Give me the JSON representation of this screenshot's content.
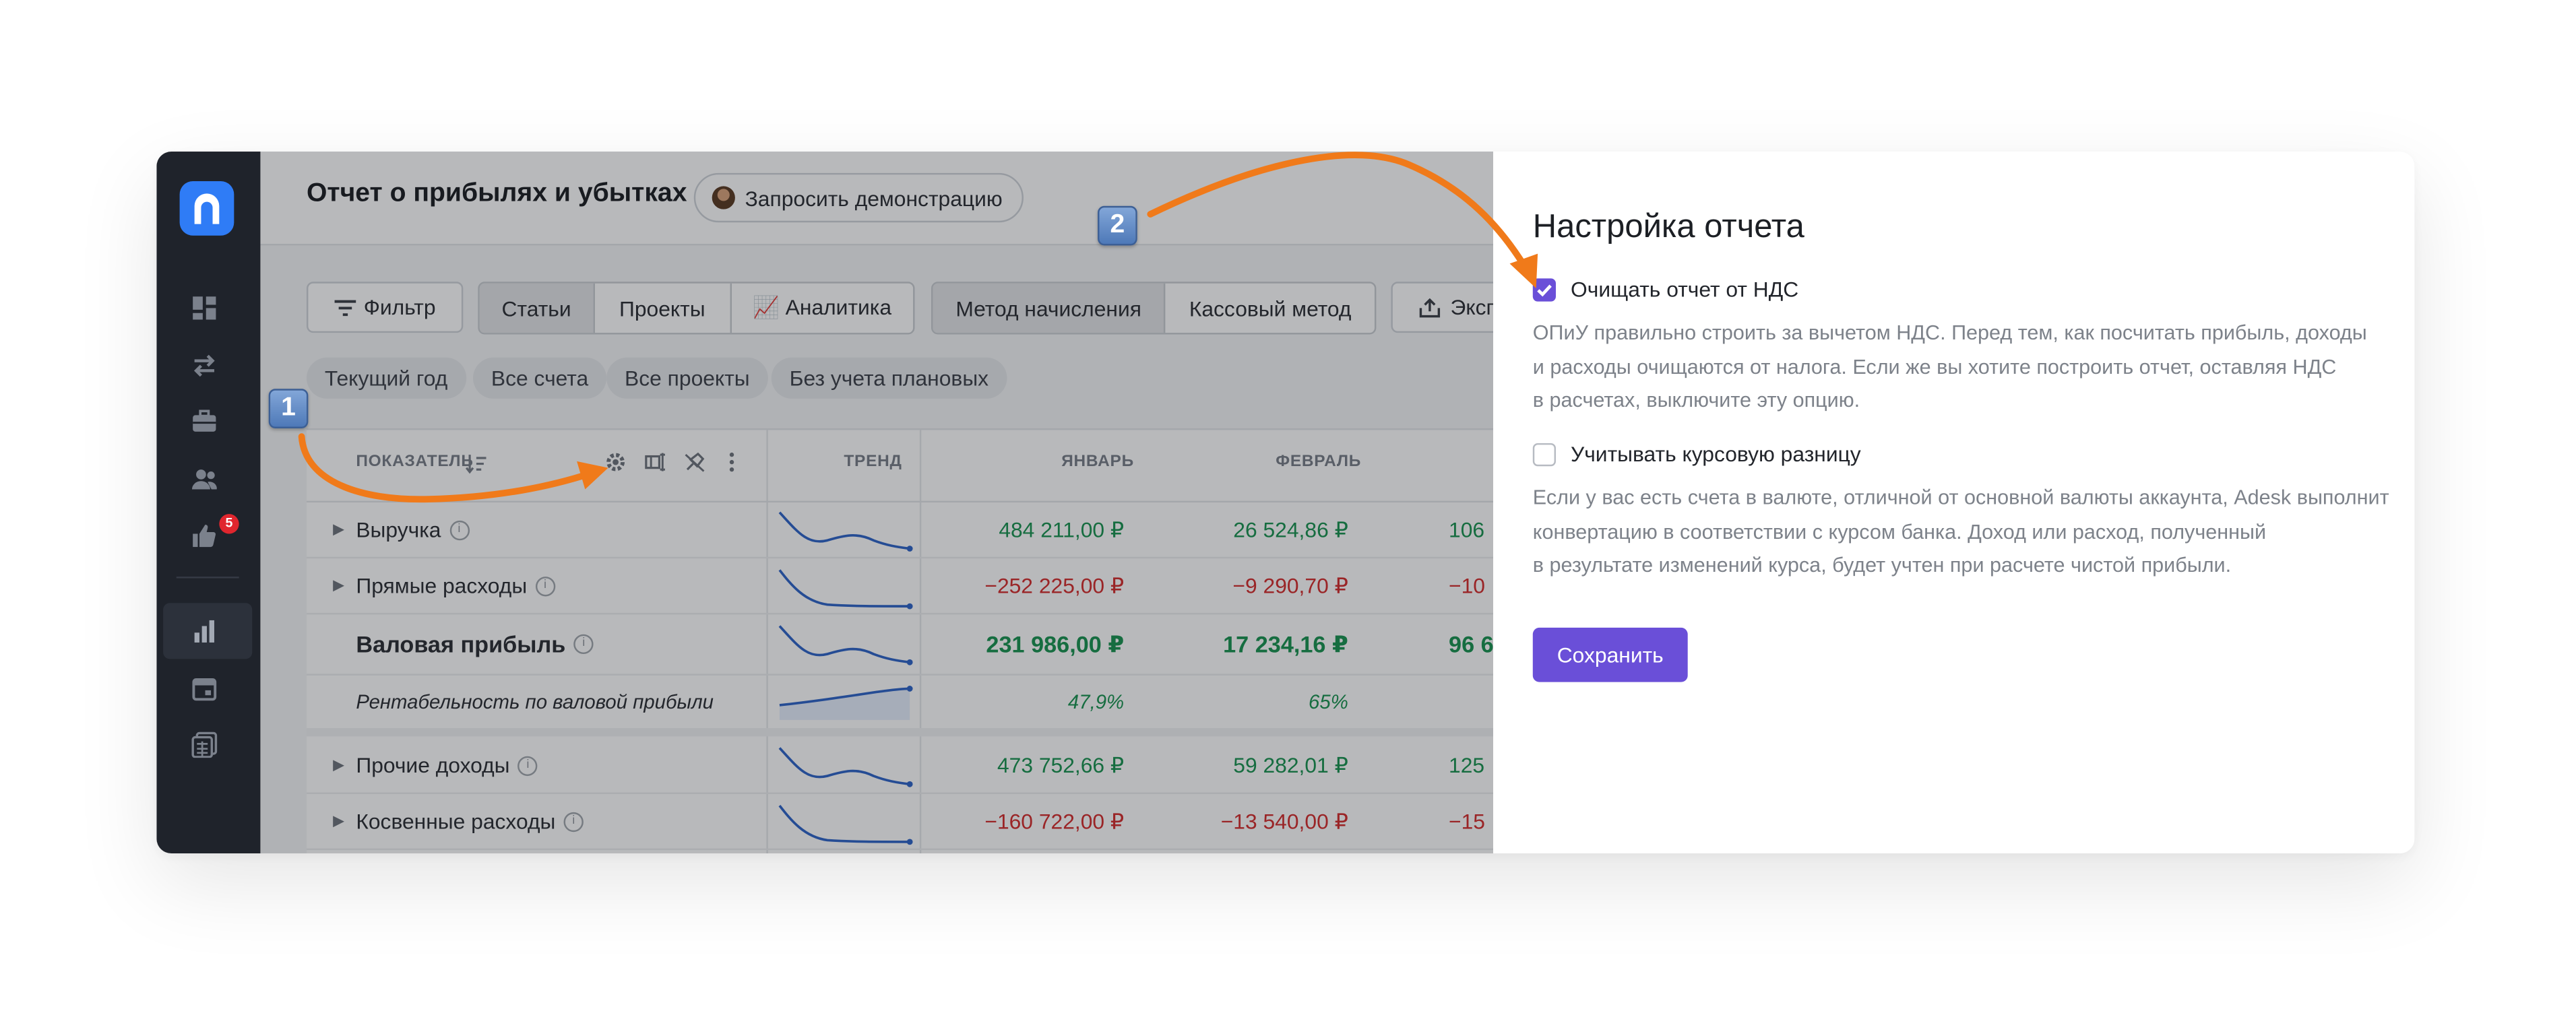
{
  "sidebar": {
    "items": [
      {
        "icon": "dashboard-icon"
      },
      {
        "icon": "transfer-arrows-icon"
      },
      {
        "icon": "briefcase-icon"
      },
      {
        "icon": "users-icon"
      },
      {
        "icon": "thumbs-up-icon",
        "badge": "5"
      },
      {
        "icon": "bar-chart-icon",
        "active": true
      },
      {
        "icon": "calendar-icon"
      },
      {
        "icon": "calculator-icon"
      }
    ]
  },
  "header": {
    "title": "Отчет о прибылях и убытках",
    "demo_button": "Запросить демонстрацию"
  },
  "toolbar": {
    "filter": "Фильтр",
    "view_tabs": [
      "Статьи",
      "Проекты",
      "📈 Аналитика"
    ],
    "method_tabs": [
      "Метод начисления",
      "Кассовый метод"
    ],
    "export": "Эксп"
  },
  "chips": [
    "Текущий год",
    "Все счета",
    "Все проекты",
    "Без учета плановых"
  ],
  "table": {
    "columns": {
      "indicator": "ПОКАЗАТЕЛЬ",
      "trend": "ТРЕНД",
      "month1": "ЯНВАРЬ",
      "month2": "ФЕВРАЛЬ"
    },
    "rows": [
      {
        "label": "Выручка",
        "v1": "484 211,00 ₽",
        "v2": "26 524,86 ₽",
        "v3": "106 "
      },
      {
        "label": "Прямые расходы",
        "v1": "−252 225,00 ₽",
        "v2": "−9 290,70 ₽",
        "v3": "−10 "
      },
      {
        "label": "Валовая прибыль",
        "v1": "231 986,00 ₽",
        "v2": "17 234,16 ₽",
        "v3": "96 6"
      },
      {
        "label": "Рентабельность по валовой прибыли",
        "v1": "47,9%",
        "v2": "65%",
        "v3": ""
      },
      {
        "label": "Прочие доходы",
        "v1": "473 752,66 ₽",
        "v2": "59 282,01 ₽",
        "v3": "125 "
      },
      {
        "label": "Косвенные расходы",
        "v1": "−160 722,00 ₽",
        "v2": "−13 540,00 ₽",
        "v3": "−15 "
      }
    ]
  },
  "panel": {
    "title": "Настройка отчета",
    "option1": {
      "label": "Очищать отчет от НДС",
      "checked": true,
      "desc": [
        "ОПиУ правильно строить за вычетом НДС. Перед тем, как посчитать прибыль, доходы",
        "и расходы очищаются от налога. Если же вы хотите построить отчет, оставляя НДС",
        "в расчетах, выключите эту опцию."
      ]
    },
    "option2": {
      "label": "Учитывать курсовую разницу",
      "checked": false,
      "desc": [
        "Если у вас есть счета в валюте, отличной от основной валюты аккаунта, Adesk выполнит",
        "конвертацию в соответствии с курсом банка. Доход или расход, полученный",
        "в результате изменений курса, будет учтен при расчете чистой прибыли."
      ]
    },
    "save": "Сохранить"
  },
  "markers": [
    "1",
    "2"
  ],
  "colors": {
    "accent": "#6a4fd8",
    "positive": "#18924f",
    "negative": "#d52b2b",
    "annotation": "#f07a1a"
  }
}
